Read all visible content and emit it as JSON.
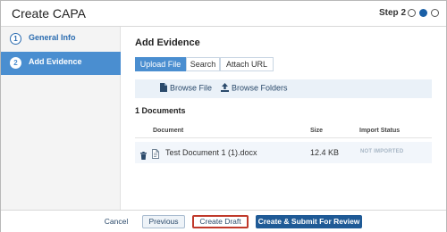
{
  "header": {
    "title": "Create CAPA",
    "step_label": "Step 2",
    "step_dots": [
      "empty",
      "filled",
      "empty"
    ]
  },
  "sidebar": {
    "items": [
      {
        "number": "1",
        "label": "General Info",
        "active": false
      },
      {
        "number": "2",
        "label": "Add Evidence",
        "active": true
      }
    ]
  },
  "main": {
    "title": "Add Evidence",
    "tabs": [
      {
        "label": "Upload File",
        "selected": true
      },
      {
        "label": "Search",
        "selected": false
      },
      {
        "label": "Attach URL",
        "selected": false
      }
    ],
    "browse": {
      "file_label": "Browse File",
      "folder_label": "Browse Folders"
    },
    "doc_count": "1 Documents",
    "table": {
      "columns": [
        "Document",
        "Size",
        "Import Status"
      ],
      "rows": [
        {
          "name": "Test Document 1 (1).docx",
          "size": "12.4 KB",
          "status": "NOT IMPORTED"
        }
      ]
    }
  },
  "footer": {
    "cancel_label": "Cancel",
    "previous_label": "Previous",
    "draft_label": "Create Draft",
    "submit_label": "Create & Submit For Review"
  },
  "colors": {
    "accent": "#4a8ed0",
    "primary_button": "#1f5a96",
    "highlight_border": "#c0392b"
  }
}
